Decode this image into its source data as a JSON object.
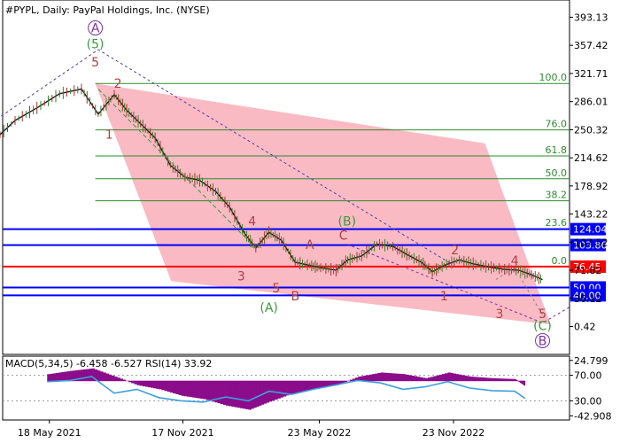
{
  "chart_data": [
    {
      "type": "line",
      "title": "#PYPL, Daily:  PayPal Holdings, Inc. (NYSE)",
      "ylim": [
        -35.0,
        415.0
      ],
      "grid": false,
      "x_ticks": [
        "18 May 2021",
        "17 Nov 2021",
        "23 May 2022",
        "23 Nov 2022"
      ],
      "y_ticks": [
        393.13,
        357.42,
        321.71,
        286.01,
        250.32,
        214.62,
        178.92,
        143.22,
        107.52,
        71.82,
        36.12,
        0.42
      ],
      "series": [
        {
          "x": [
            "2021-03-01",
            "2021-04-01",
            "2021-05-01",
            "2021-06-01",
            "2021-07-01",
            "2021-07-24",
            "2021-08-15",
            "2021-09-01",
            "2021-09-20",
            "2021-10-10",
            "2021-10-31",
            "2021-11-20",
            "2021-12-10",
            "2022-01-01",
            "2022-01-20",
            "2022-02-10",
            "2022-02-25",
            "2022-03-15",
            "2022-04-01",
            "2022-04-20",
            "2022-05-10",
            "2022-05-25",
            "2022-06-15",
            "2022-07-01",
            "2022-07-20",
            "2022-08-10",
            "2022-09-01",
            "2022-09-20",
            "2022-10-10",
            "2022-10-25",
            "2022-11-10",
            "2022-12-01",
            "2022-12-20",
            "2023-01-10",
            "2023-02-01",
            "2023-02-20",
            "2023-03-10",
            "2023-03-25"
          ],
          "values": [
            235,
            262,
            278,
            296,
            302,
            270,
            295,
            275,
            258,
            240,
            205,
            190,
            186,
            172,
            152,
            118,
            100,
            120,
            110,
            82,
            78,
            75,
            72,
            85,
            90,
            105,
            102,
            92,
            82,
            70,
            78,
            85,
            80,
            76,
            73,
            72,
            66,
            60
          ]
        },
        {
          "name": "",
          "x": [
            "2021-03-01",
            "2021-07-24",
            "2022-11-20"
          ],
          "values": [
            260,
            352,
            80
          ]
        }
      ],
      "levels": [
        {
          "label": "100.0",
          "value": 309.0,
          "color": "#2e8b2e"
        },
        {
          "label": "76.0",
          "value": 250.0,
          "color": "#2e8b2e"
        },
        {
          "label": "61.8",
          "value": 217.0,
          "color": "#2e8b2e"
        },
        {
          "label": "50.0",
          "value": 188.0,
          "color": "#2e8b2e"
        },
        {
          "label": "38.2",
          "value": 160.0,
          "color": "#2e8b2e"
        },
        {
          "label": "23.6",
          "value": 124.5,
          "color": "#2e8b2e"
        },
        {
          "label": "0.0",
          "value": 76.45,
          "color": "#2e8b2e"
        }
      ],
      "price_lines": [
        {
          "label": "124.04",
          "value": 124.04,
          "color": "#0000ff"
        },
        {
          "label": "103.86",
          "value": 103.86,
          "color": "#0000ff"
        },
        {
          "label": "76.45",
          "value": 76.45,
          "color": "#ff0000"
        },
        {
          "label": "50.00",
          "value": 50.0,
          "color": "#0000ff"
        },
        {
          "label": "40.00",
          "value": 40.0,
          "color": "#0000ff"
        }
      ],
      "wave_labels": [
        {
          "text": "A",
          "x": "2021-07-20",
          "y": 375,
          "color": "#7b2fa8",
          "circled": true
        },
        {
          "text": "(5)",
          "x": "2021-07-20",
          "y": 355,
          "color": "#3a9b3a"
        },
        {
          "text": "5",
          "x": "2021-07-20",
          "y": 332,
          "color": "#b04040"
        },
        {
          "text": "2",
          "x": "2021-08-20",
          "y": 305,
          "color": "#b04040"
        },
        {
          "text": "1",
          "x": "2021-08-08",
          "y": 240,
          "color": "#b04040"
        },
        {
          "text": "4",
          "x": "2022-02-20",
          "y": 130,
          "color": "#b04040"
        },
        {
          "text": "3",
          "x": "2022-02-05",
          "y": 60,
          "color": "#b04040"
        },
        {
          "text": "(B)",
          "x": "2022-06-30",
          "y": 130,
          "color": "#3a9b3a"
        },
        {
          "text": "A",
          "x": "2022-05-10",
          "y": 100,
          "color": "#b04040"
        },
        {
          "text": "C",
          "x": "2022-06-25",
          "y": 112,
          "color": "#b04040"
        },
        {
          "text": "5",
          "x": "2022-03-25",
          "y": 45,
          "color": "#b04040"
        },
        {
          "text": "B",
          "x": "2022-04-20",
          "y": 35,
          "color": "#b04040"
        },
        {
          "text": "(A)",
          "x": "2022-03-15",
          "y": 20,
          "color": "#3a9b3a"
        },
        {
          "text": "2",
          "x": "2022-11-25",
          "y": 93,
          "color": "#b04040"
        },
        {
          "text": "1",
          "x": "2022-11-10",
          "y": 35,
          "color": "#b04040"
        },
        {
          "text": "4",
          "x": "2023-02-15",
          "y": 80,
          "color": "#b04040"
        },
        {
          "text": "3",
          "x": "2023-01-25",
          "y": 12,
          "color": "#b04040"
        },
        {
          "text": "5",
          "x": "2023-03-25",
          "y": 12,
          "color": "#b04040"
        },
        {
          "text": "(C)",
          "x": "2023-03-25",
          "y": -3,
          "color": "#3a9b3a"
        },
        {
          "text": "B",
          "x": "2023-03-25",
          "y": -22,
          "color": "#7b2fa8",
          "circled": true
        }
      ],
      "channel": [
        {
          "x": "2021-07-20",
          "y": 309
        },
        {
          "x": "2023-01-05",
          "y": 233
        },
        {
          "x": "2023-04-05",
          "y": 3
        },
        {
          "x": "2021-11-01",
          "y": 58
        }
      ]
    },
    {
      "type": "bar",
      "title": "MACD(5,34,5) -6.458 -6.527 RSI(14) 33.92",
      "ylim": [
        -48.0,
        30.0
      ],
      "y_ticks": [
        24.799,
        70.0,
        30.0,
        -42.908
      ],
      "series": [
        {
          "name": "MACD",
          "x": [
            "2021-05-15",
            "2021-06-15",
            "2021-07-15",
            "2021-08-15",
            "2021-09-15",
            "2021-10-15",
            "2021-11-15",
            "2021-12-15",
            "2022-01-15",
            "2022-02-15",
            "2022-03-15",
            "2022-04-15",
            "2022-05-15",
            "2022-06-15",
            "2022-07-15",
            "2022-08-15",
            "2022-09-15",
            "2022-10-15",
            "2022-11-15",
            "2022-12-15",
            "2023-01-15",
            "2023-02-15",
            "2023-03-01"
          ],
          "values": [
            8,
            12,
            15,
            5,
            -5,
            -10,
            -18,
            -22,
            -30,
            -35,
            -25,
            -15,
            -10,
            -5,
            5,
            10,
            8,
            3,
            10,
            5,
            3,
            2,
            -6.458
          ]
        },
        {
          "name": "RSI",
          "x": [
            "2021-05-15",
            "2021-06-15",
            "2021-07-15",
            "2021-08-15",
            "2021-09-15",
            "2021-10-15",
            "2021-11-15",
            "2021-12-15",
            "2022-01-15",
            "2022-02-15",
            "2022-03-15",
            "2022-04-15",
            "2022-05-15",
            "2022-06-15",
            "2022-07-15",
            "2022-08-15",
            "2022-09-15",
            "2022-10-15",
            "2022-11-15",
            "2022-12-15",
            "2023-01-15",
            "2023-02-15",
            "2023-03-01"
          ],
          "values": [
            60,
            62,
            68,
            42,
            48,
            35,
            30,
            28,
            36,
            30,
            45,
            40,
            48,
            55,
            62,
            58,
            48,
            52,
            60,
            50,
            46,
            45,
            33.92
          ]
        }
      ],
      "rsi_levels": [
        70,
        30
      ]
    }
  ]
}
